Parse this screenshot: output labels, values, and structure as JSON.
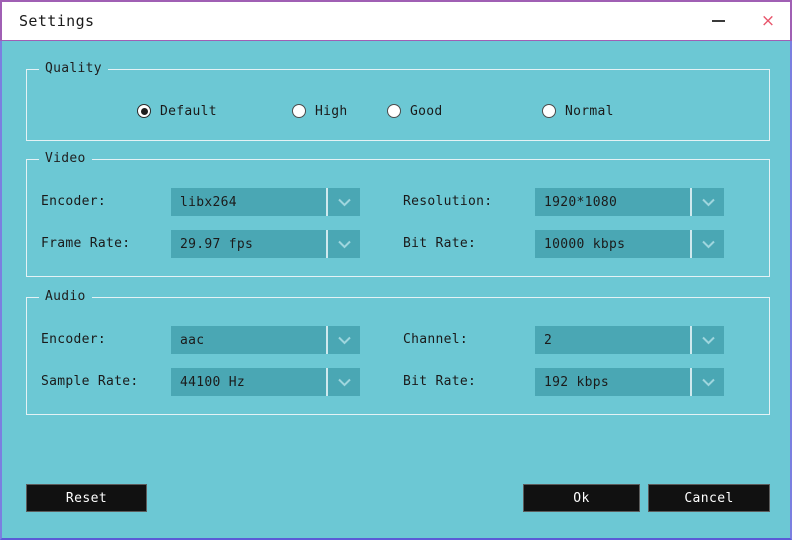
{
  "window": {
    "title": "Settings",
    "minimize_label": "—",
    "close_label": "×",
    "accent_border": "#7b7fe0",
    "titlebar_border": "#a05fb4",
    "background": "#6cc8d4",
    "field_background": "#4aa7b4"
  },
  "quality": {
    "legend": "Quality",
    "options": [
      {
        "label": "Default",
        "selected": true
      },
      {
        "label": "High",
        "selected": false
      },
      {
        "label": "Good",
        "selected": false
      },
      {
        "label": "Normal",
        "selected": false
      }
    ]
  },
  "video": {
    "legend": "Video",
    "fields": [
      {
        "label": "Encoder:",
        "value": "libx264"
      },
      {
        "label": "Resolution:",
        "value": "1920*1080"
      },
      {
        "label": "Frame Rate:",
        "value": "29.97 fps"
      },
      {
        "label": "Bit Rate:",
        "value": "10000 kbps"
      }
    ]
  },
  "audio": {
    "legend": "Audio",
    "fields": [
      {
        "label": "Encoder:",
        "value": "aac"
      },
      {
        "label": "Channel:",
        "value": "2"
      },
      {
        "label": "Sample Rate:",
        "value": "44100 Hz"
      },
      {
        "label": "Bit Rate:",
        "value": "192 kbps"
      }
    ]
  },
  "buttons": {
    "reset": "Reset",
    "ok": "Ok",
    "cancel": "Cancel"
  }
}
